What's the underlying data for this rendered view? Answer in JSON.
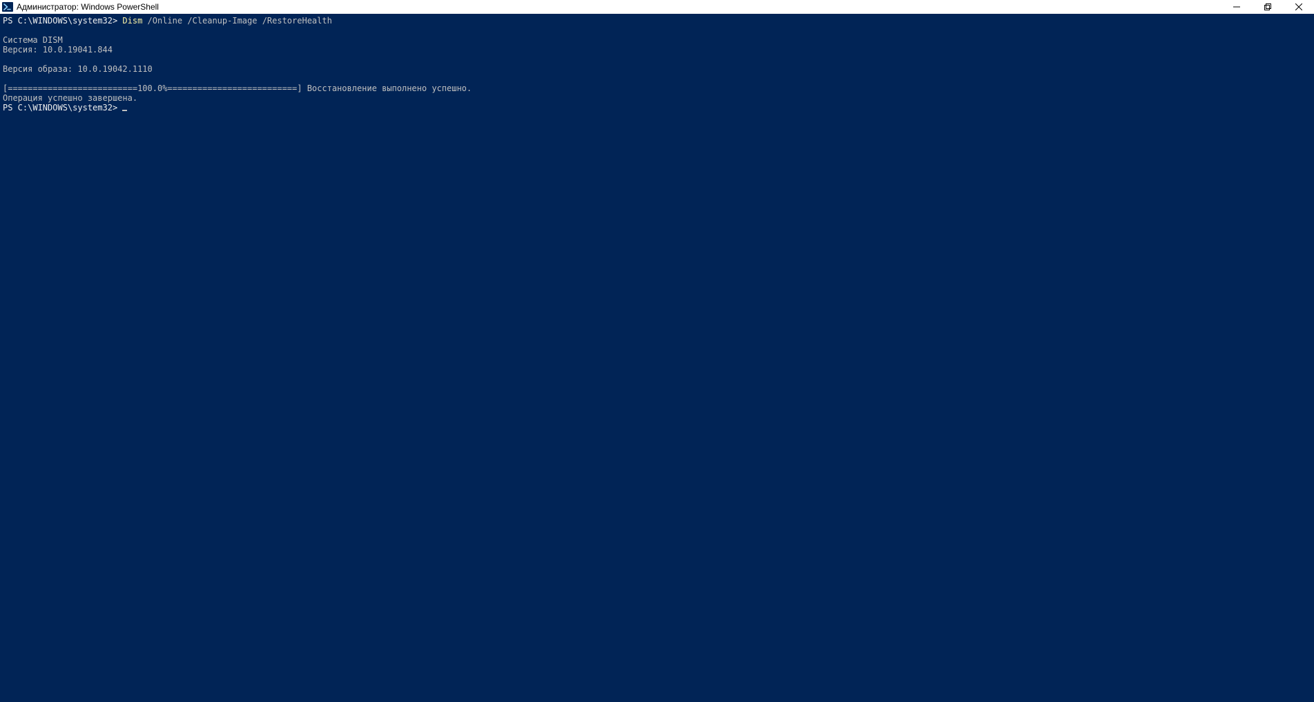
{
  "window": {
    "title": "Администратор: Windows PowerShell",
    "min_tooltip": "Minimize",
    "max_tooltip": "Maximize",
    "close_tooltip": "Close"
  },
  "terminal": {
    "prompt1_prefix": "PS C:\\WINDOWS\\system32> ",
    "prompt1_cmd_yellow": "Dism",
    "prompt1_cmd_rest": " /Online /Cleanup-Image /RestoreHealth",
    "blank1": "",
    "out_line1": "Cистема DISM",
    "out_line2": "Версия: 10.0.19041.844",
    "blank2": "",
    "out_line3": "Версия образа: 10.0.19042.1110",
    "blank3": "",
    "out_line4": "[==========================100.0%==========================] Восстановление выполнено успешно.",
    "out_line5": "Операция успешно завершена.",
    "prompt2_prefix": "PS C:\\WINDOWS\\system32> "
  }
}
